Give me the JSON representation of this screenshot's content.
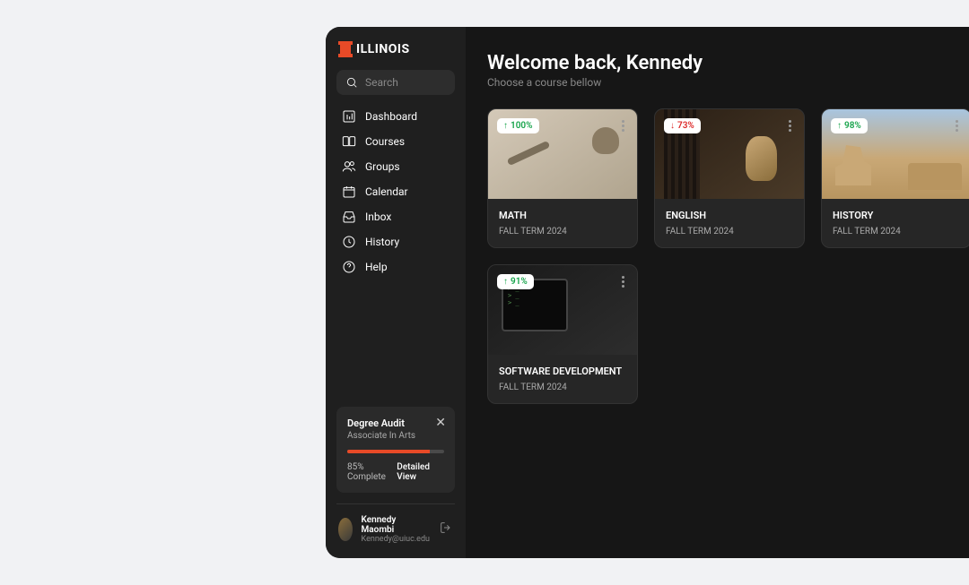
{
  "brand": "ILLINOIS",
  "search": {
    "placeholder": "Search"
  },
  "nav": {
    "items": [
      {
        "label": "Dashboard"
      },
      {
        "label": "Courses"
      },
      {
        "label": "Groups"
      },
      {
        "label": "Calendar"
      },
      {
        "label": "Inbox"
      },
      {
        "label": "History"
      },
      {
        "label": "Help"
      }
    ]
  },
  "degree_audit": {
    "title": "Degree Audit",
    "subtitle": "Associate In Arts",
    "percent_text": "85% Complete",
    "percent_value": 85,
    "link": "Detailed View"
  },
  "user": {
    "name": "Kennedy Maombi",
    "email": "Kennedy@uiuc.edu"
  },
  "main": {
    "title": "Welcome back, Kennedy",
    "subtitle": "Choose a course bellow"
  },
  "courses": [
    {
      "title": "MATH",
      "term": "FALL TERM 2024",
      "badge_pct": "100%",
      "badge_dir": "up"
    },
    {
      "title": "ENGLISH",
      "term": "FALL TERM 2024",
      "badge_pct": "73%",
      "badge_dir": "down"
    },
    {
      "title": "HISTORY",
      "term": "FALL TERM 2024",
      "badge_pct": "98%",
      "badge_dir": "up"
    },
    {
      "title": "SOFTWARE DEVELOPMENT",
      "term": "FALL TERM 2024",
      "badge_pct": "91%",
      "badge_dir": "up"
    }
  ]
}
